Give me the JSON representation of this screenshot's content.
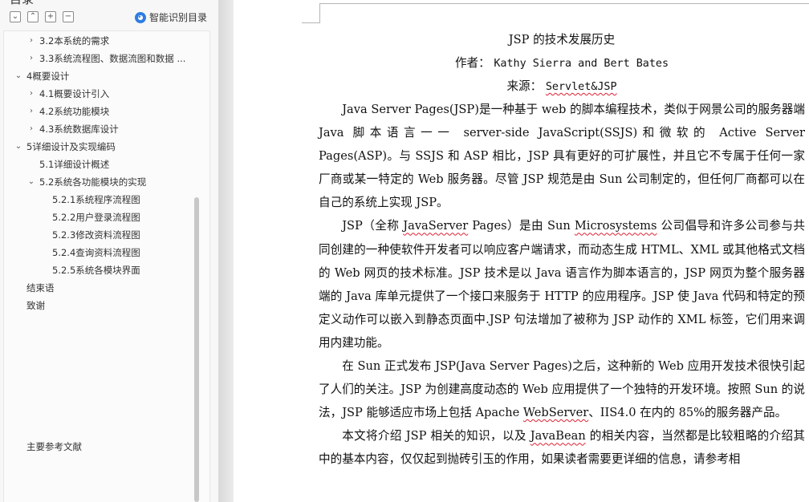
{
  "nav": {
    "title": "目录",
    "toolbar": [
      "⌄",
      "⌃",
      "+",
      "−"
    ],
    "smart_toc_label": "智能识别目录",
    "items": [
      {
        "label": "3.2本系统的需求",
        "chev": "›"
      },
      {
        "label": "3.3系统流程图、数据流图和数据 ...",
        "chev": "›"
      },
      {
        "label": "4概要设计",
        "chev": "⌄"
      },
      {
        "label": "4.1概要设计引入",
        "chev": "›"
      },
      {
        "label": "4.2系统功能模块",
        "chev": "›"
      },
      {
        "label": "4.3系统数据库设计",
        "chev": "›"
      },
      {
        "label": "5详细设计及实现编码",
        "chev": "⌄"
      },
      {
        "label": "5.1详细设计概述",
        "chev": ""
      },
      {
        "label": "5.2系统各功能模块的实现",
        "chev": "⌄"
      },
      {
        "label": "5.2.1系统程序流程图",
        "chev": ""
      },
      {
        "label": "5.2.2用户登录流程图",
        "chev": ""
      },
      {
        "label": "5.2.3修改资料流程图",
        "chev": ""
      },
      {
        "label": "5.2.4查询资料流程图",
        "chev": ""
      },
      {
        "label": "5.2.5系统各模块界面",
        "chev": ""
      },
      {
        "label": "结束语",
        "chev": ""
      },
      {
        "label": "致谢",
        "chev": ""
      },
      {
        "label": "主要参考文献",
        "chev": ""
      }
    ]
  },
  "doc": {
    "title": "JSP 的技术发展历史",
    "author_label": "作者：",
    "author": "Kathy Sierra and Bert Bates",
    "source_label": "来源：",
    "source": "Servlet&JSP",
    "p1": "Java Server Pages(JSP)是一种基于 web 的脚本编程技术，类似于网景公司的服务器端 Java 脚本语言一一 server-side JavaScript(SSJS)和微软的 Active Server Pages(ASP)。与 SSJS 和 ASP 相比，JSP 具有更好的可扩展性，并且它不专属于任何一家厂商或某一特定的 Web 服务器。尽管 JSP 规范是由 Sun 公司制定的，但任何厂商都可以在自己的系统上实现 JSP。",
    "p2a": "JSP（全称 ",
    "p2b": "JavaServer",
    "p2c": " Pages）是由 Sun ",
    "p2d": "Microsystems",
    "p2e": " 公司倡导和许多公司参与共同创建的一种使软件开发者可以响应客户端请求，而动态生成 HTML、XML 或其他格式文档的 Web 网页的技术标准。JSP 技术是以 Java 语言作为脚本语言的，JSP 网页为整个服务器端的 Java 库单元提供了一个接口来服务于 HTTP 的应用程序。JSP 使 Java 代码和特定的预定义动作可以嵌入到静态页面中.JSP 句法增加了被称为 JSP 动作的 XML 标签，它们用来调用内建功能。",
    "p3a": "在 Sun 正式发布 JSP(Java Server Pages)之后，这种新的 Web 应用开发技术很快引起了人们的关注。JSP 为创建高度动态的 Web 应用提供了一个独特的开发环境。按照 Sun 的说法，JSP 能够适应市场上包括 Apache ",
    "p3b": "WebServer",
    "p3c": "、IIS4.0 在内的 85%的服务器产品。",
    "p4a": "本文将介绍 JSP 相关的知识，以及 ",
    "p4b": "JavaBean",
    "p4c": " 的相关内容，当然都是比较粗略的介绍其中的基本内容，仅仅起到抛砖引玉的作用，如果读者需要更详细的信息，请参考相"
  }
}
